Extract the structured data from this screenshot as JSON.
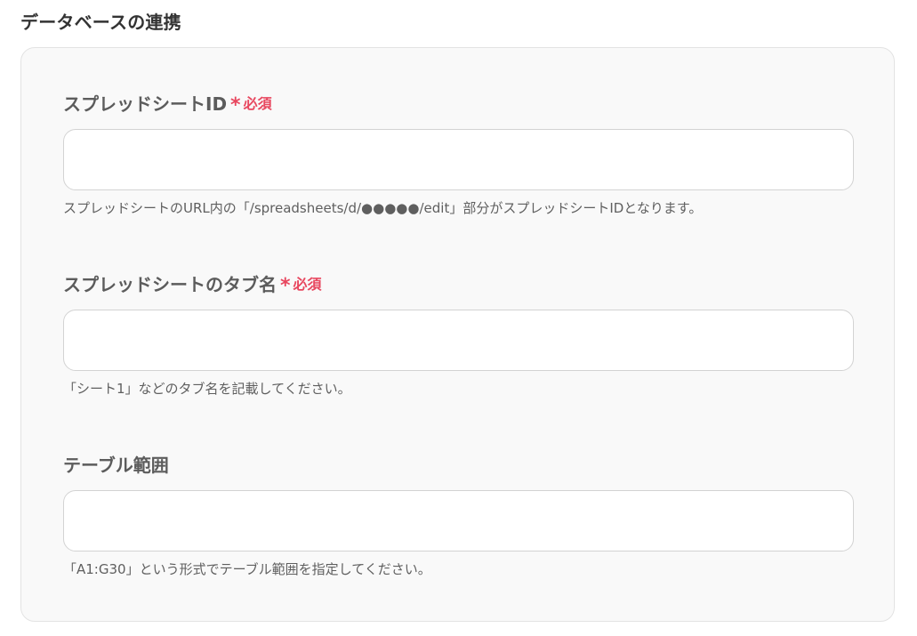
{
  "section": {
    "title": "データベースの連携"
  },
  "fields": [
    {
      "label": "スプレッドシートID",
      "required_mark": "*",
      "required_text": "必須",
      "value": "",
      "hint": "スプレッドシートのURL内の「/spreadsheets/d/●●●●●/edit」部分がスプレッドシートIDとなります。"
    },
    {
      "label": "スプレッドシートのタブ名",
      "required_mark": "*",
      "required_text": "必須",
      "value": "",
      "hint": "「シート1」などのタブ名を記載してください。"
    },
    {
      "label": "テーブル範囲",
      "value": "",
      "hint": "「A1:G30」という形式でテーブル範囲を指定してください。"
    }
  ],
  "colors": {
    "required": "#e8475f",
    "card_background": "#f9f9f9",
    "label": "#5c5c5c"
  }
}
